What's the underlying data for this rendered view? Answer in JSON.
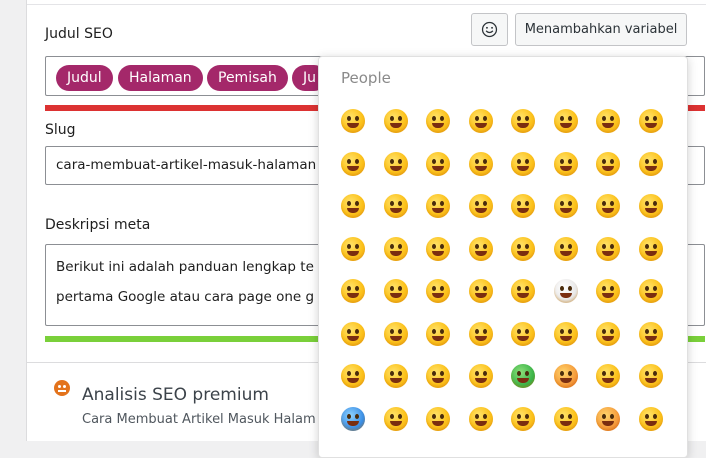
{
  "seo_title": {
    "label": "Judul SEO",
    "pills": [
      "Judul",
      "Halaman",
      "Pemisah",
      "Ju"
    ],
    "emoji_button_icon": "smiley-icon",
    "add_variable_button": "Menambahkan variabel"
  },
  "slug": {
    "label": "Slug",
    "value": "cara-membuat-artikel-masuk-halaman"
  },
  "meta_description": {
    "label": "Deskripsi meta",
    "line1": "Berikut ini adalah panduan lengkap te",
    "line2": "pertama Google atau cara page one g"
  },
  "analysis": {
    "title": "Analisis SEO premium",
    "subtitle": "Cara Membuat Artikel Masuk Halam"
  },
  "emoji_picker": {
    "category": "People",
    "rows": 8,
    "cols": 8
  },
  "colors": {
    "pill": "#a4286a",
    "title_bar": "#dc3232",
    "description_bar": "#7ad03a",
    "analysis_icon": "#e3731c"
  }
}
